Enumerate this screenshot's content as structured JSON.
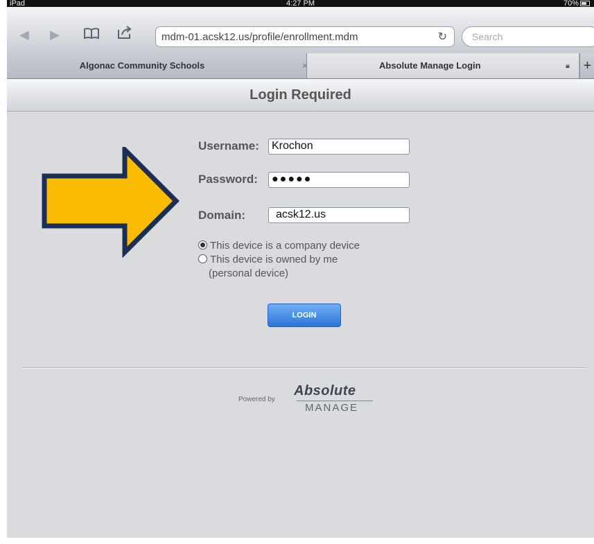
{
  "status_bar": {
    "device": "iPad",
    "time": "4:27 PM",
    "battery": "70%"
  },
  "toolbar": {
    "url": "mdm-01.acsk12.us/profile/enrollment.mdm",
    "search_placeholder": "Search"
  },
  "tabs": [
    {
      "label": "Algonac Community Schools",
      "close": "×"
    },
    {
      "label": "Absolute Manage Login"
    }
  ],
  "header": {
    "title": "Login Required"
  },
  "form": {
    "username_label": "Username:",
    "username_value": "Krochon",
    "password_label": "Password:",
    "password_value": "●●●●●",
    "domain_label": "Domain:",
    "domain_value": "acsk12.us",
    "radio_company": "This device is a company device",
    "radio_personal": "This device is owned by me",
    "radio_personal_sub": "(personal device)",
    "selected_option": "company",
    "login_label": "LOGIN"
  },
  "footer": {
    "powered_by": "Powered by",
    "brand_name": "Absolute",
    "brand_product": "MANAGE"
  },
  "annotation": {
    "arrow_color": "#fbbb00",
    "arrow_border": "#1c2f52"
  }
}
